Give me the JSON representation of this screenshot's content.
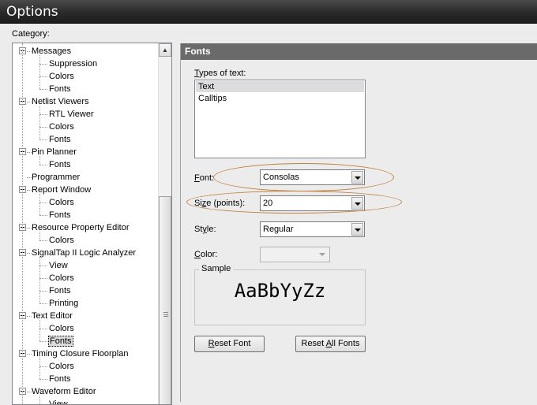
{
  "window": {
    "title": "Options"
  },
  "category_label": "Category:",
  "tree": [
    {
      "label": "Messages",
      "level": 0,
      "expanded": true
    },
    {
      "label": "Suppression",
      "level": 1
    },
    {
      "label": "Colors",
      "level": 1
    },
    {
      "label": "Fonts",
      "level": 1
    },
    {
      "label": "Netlist Viewers",
      "level": 0,
      "expanded": true
    },
    {
      "label": "RTL Viewer",
      "level": 1
    },
    {
      "label": "Colors",
      "level": 1
    },
    {
      "label": "Fonts",
      "level": 1
    },
    {
      "label": "Pin Planner",
      "level": 0,
      "expanded": true
    },
    {
      "label": "Fonts",
      "level": 1
    },
    {
      "label": "Programmer",
      "level": 0
    },
    {
      "label": "Report Window",
      "level": 0,
      "expanded": true
    },
    {
      "label": "Colors",
      "level": 1
    },
    {
      "label": "Fonts",
      "level": 1
    },
    {
      "label": "Resource Property Editor",
      "level": 0,
      "expanded": true
    },
    {
      "label": "Colors",
      "level": 1
    },
    {
      "label": "SignalTap II Logic Analyzer",
      "level": 0,
      "expanded": true
    },
    {
      "label": "View",
      "level": 1
    },
    {
      "label": "Colors",
      "level": 1
    },
    {
      "label": "Fonts",
      "level": 1
    },
    {
      "label": "Printing",
      "level": 1
    },
    {
      "label": "Text Editor",
      "level": 0,
      "expanded": true
    },
    {
      "label": "Colors",
      "level": 1
    },
    {
      "label": "Fonts",
      "level": 1,
      "selected": true
    },
    {
      "label": "Timing Closure Floorplan",
      "level": 0,
      "expanded": true
    },
    {
      "label": "Colors",
      "level": 1
    },
    {
      "label": "Fonts",
      "level": 1
    },
    {
      "label": "Waveform Editor",
      "level": 0,
      "expanded": true
    },
    {
      "label": "View",
      "level": 1
    }
  ],
  "panel": {
    "header": "Fonts",
    "types_label_pre": "",
    "types_label_key": "T",
    "types_label_post": "ypes of text:",
    "types": [
      {
        "label": "Text",
        "selected": true
      },
      {
        "label": "Calltips"
      }
    ],
    "font_label_pre": "",
    "font_label_key": "F",
    "font_label_post": "ont:",
    "font_value": "Consolas",
    "size_label_pre": "Si",
    "size_label_key": "z",
    "size_label_post": "e (points):",
    "size_value": "20",
    "style_label_pre": "St",
    "style_label_key": "y",
    "style_label_post": "le:",
    "style_value": "Regular",
    "color_label_pre": "",
    "color_label_key": "C",
    "color_label_post": "olor:",
    "sample_legend": "Sample",
    "sample_text": "AaBbYyZz",
    "reset_font_pre": "",
    "reset_font_key": "R",
    "reset_font_post": "eset Font",
    "reset_all_pre": "Reset ",
    "reset_all_key": "A",
    "reset_all_post": "ll Fonts"
  },
  "colors": {
    "titlebar": "#2a2a2a",
    "panel_header": "#6a6a6a",
    "highlight_ellipse": "#c08040"
  }
}
